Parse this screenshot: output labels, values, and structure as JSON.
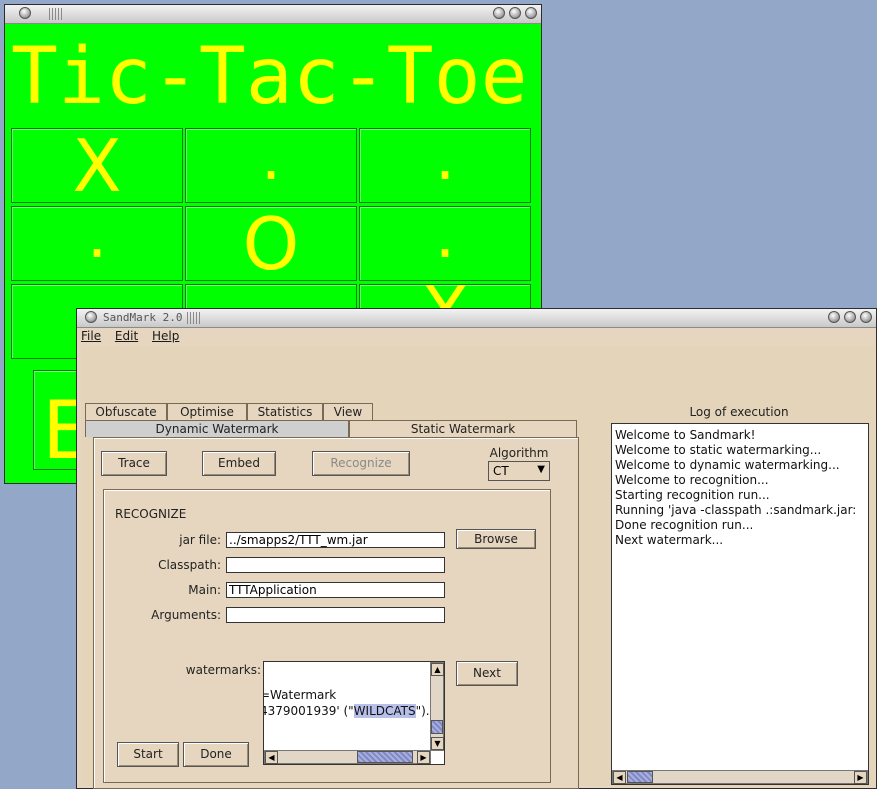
{
  "ttt": {
    "title": "",
    "heading": "Tic-Tac-Toe",
    "cells": [
      "X",
      ".",
      ".",
      ".",
      "O",
      ".",
      "",
      "",
      "X"
    ],
    "status": "E"
  },
  "sandmark": {
    "title": "SandMark 2.0",
    "menu": {
      "file": "File",
      "edit": "Edit",
      "help": "Help"
    },
    "top_tabs": [
      "Obfuscate",
      "Optimise",
      "Statistics",
      "View"
    ],
    "sub_tabs": {
      "dynamic": "Dynamic Watermark",
      "static": "Static Watermark"
    },
    "buttons": {
      "trace": "Trace",
      "embed": "Embed",
      "recognize": "Recognize",
      "browse": "Browse",
      "next": "Next",
      "start": "Start",
      "done": "Done"
    },
    "algorithm": {
      "label": "Algorithm",
      "value": "CT"
    },
    "recognize": {
      "section_title": "RECOGNIZE",
      "jar_label": "jar file:",
      "jar_value": "../smapps2/TTT_wm.jar",
      "classpath_label": "Classpath:",
      "classpath_value": "",
      "main_label": "Main:",
      "main_value": "TTTApplication",
      "args_label": "Arguments:",
      "args_value": "",
      "watermarks_label": "watermarks:",
      "watermarks_line1": "=Watermark",
      "watermarks_line2_prefix": "4379001939' (\"",
      "watermarks_highlight": "WILDCATS",
      "watermarks_line2_suffix": "\")."
    },
    "log": {
      "title": "Log of execution",
      "lines": [
        "Welcome to Sandmark!",
        "Welcome to static watermarking...",
        "Welcome to dynamic watermarking...",
        "Welcome to recognition...",
        "Starting recognition run...",
        "Running 'java -classpath .:sandmark.jar:/ho",
        "Done recognition run...",
        "Next watermark..."
      ]
    }
  }
}
